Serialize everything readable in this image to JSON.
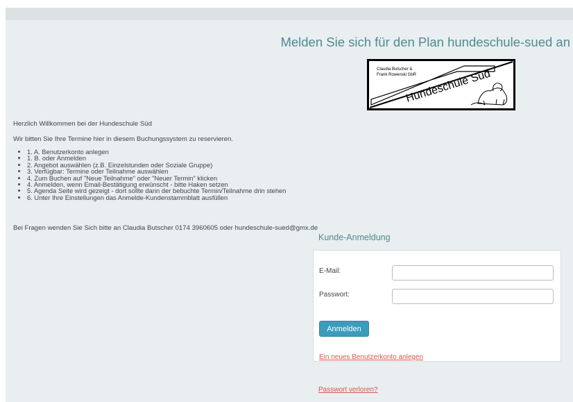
{
  "header": {
    "title": "Melden Sie sich für den Plan hundeschule-sued an"
  },
  "logo": {
    "owner_line_1": "Claudia Butscher &",
    "owner_line_2": "Frank Rowenski GbR",
    "brand": "Hundeschule Süd"
  },
  "intro": {
    "welcome": "Herzlich Willkommen bei der Hundeschule Süd",
    "request": "Wir bitten Sie Ihre Termine hier in diesem Buchungssystem zu reservieren.",
    "steps": [
      "1. A. Benutzerkonto anlegen",
      "1. B. oder Anmelden",
      "2. Angebot auswählen (z.B. Einzelstunden oder Soziale Gruppe)",
      "3. Verfügbar: Termine oder Teilnahme auswählen",
      "4. Zum Buchen auf \"Neue Teilnahme\" oder \"Neuer Termin\" klicken",
      "4. Anmelden, wenn Email-Bestätigung erwünscht - bitte Haken setzen",
      "5. Agenda Seite wird gezeigt - dort sollte dann der bebuchte Termin/Teilnahme drin stehen",
      "6. Unter Ihre Einstellungen das Anmelde-Kundenstammblatt ausfüllen"
    ],
    "contact": "Bei Fragen wenden Sie Sich bitte an Claudia Butscher 0174 3960605 oder hundeschule-sued@gmx.de"
  },
  "login": {
    "title": "Kunde-Anmeldung",
    "email_label": "E-Mail:",
    "email_value": "",
    "password_label": "Passwort:",
    "password_value": "",
    "submit_label": "Anmelden",
    "register_link": "Ein neues Benutzerkonto anlegen",
    "lost_password_link": "Passwort verloren?"
  },
  "colors": {
    "accent_teal": "#4f8a91",
    "button_blue": "#3d9cbc",
    "link_red": "#d8564e",
    "page_background": "#e9eef0"
  }
}
